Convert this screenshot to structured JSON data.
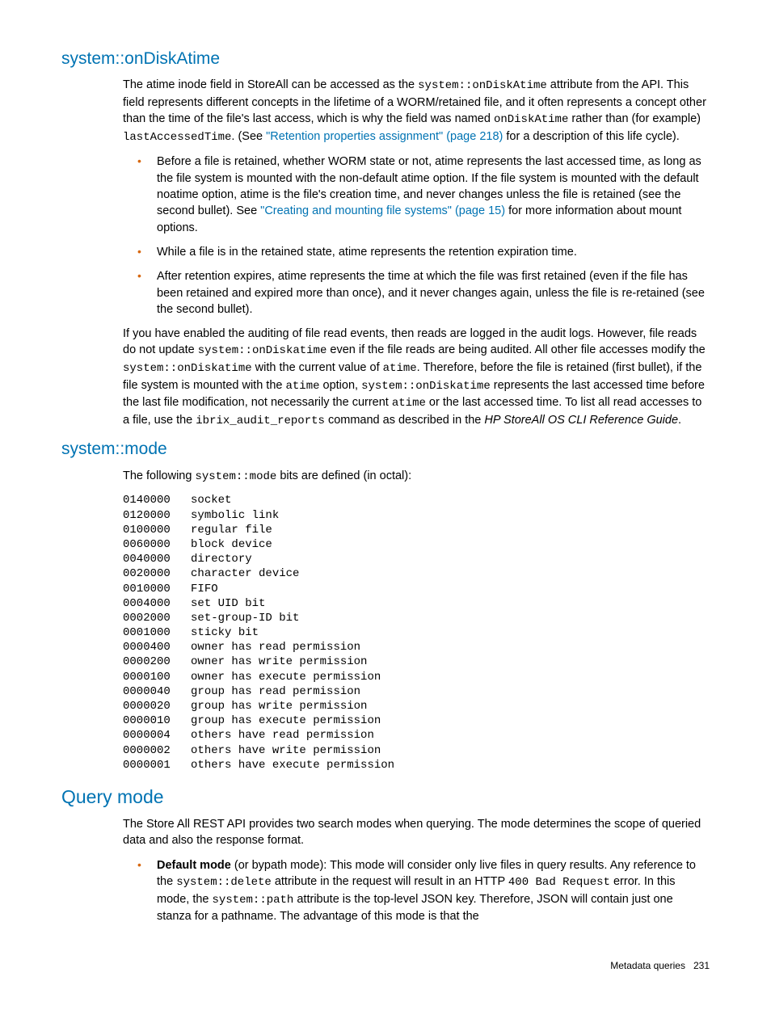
{
  "s1": {
    "h": "system::onDiskAtime",
    "p1a": "The atime inode field in StoreAll can be accessed as the ",
    "p1b": "system::onDiskAtime",
    "p1c": " attribute from the API. This field represents different concepts in the lifetime of a WORM/retained file, and it often represents a concept other than the time of the file's last access, which is why the field was named ",
    "p1d": "onDiskAtime",
    "p1e": " rather than (for example) ",
    "p1f": "lastAccessedTime",
    "p1g": ". (See ",
    "p1h": "\"Retention properties assignment\" (page 218)",
    "p1i": " for a description of this life cycle).",
    "b1a": "Before a file is retained, whether WORM state or not, atime represents the last accessed time, as long as the file system is mounted with the non-default atime option. If the file system is mounted with the default noatime option, atime is the file's creation time, and never changes unless the file is retained (see the second bullet). See ",
    "b1b": "\"Creating and mounting file systems\" (page 15)",
    "b1c": " for more information about mount options.",
    "b2": "While a file is in the retained state, atime represents the retention expiration time.",
    "b3": "After retention expires, atime represents the time at which the file was first retained (even if the file has been retained and expired more than once), and it never changes again, unless the file is re-retained (see the second bullet).",
    "p2a": "If you have enabled the auditing of file read events, then reads are logged in the audit logs. However, file reads do not update ",
    "p2b": "system::onDiskatime",
    "p2c": " even if the file reads are being audited. All other file accesses modify the ",
    "p2d": "system::onDiskatime",
    "p2e": " with the current value of ",
    "p2f": "atime",
    "p2g": ". Therefore, before the file is retained (first bullet), if the file system is mounted with the ",
    "p2h": "atime",
    "p2i": " option, ",
    "p2j": "system::onDiskatime",
    "p2k": " represents the last accessed time before the last file modification, not necessarily the current ",
    "p2l": "atime",
    "p2m": " or the last accessed time. To list all read accesses to a file, use the ",
    "p2n": "ibrix_audit_reports",
    "p2o": " command as described in the ",
    "p2p": "HP StoreAll OS CLI Reference Guide",
    "p2q": "."
  },
  "s2": {
    "h": "system::mode",
    "p1a": "The following ",
    "p1b": " system::mode",
    "p1c": " bits are defined (in octal):",
    "pre": "0140000   socket\n0120000   symbolic link\n0100000   regular file\n0060000   block device\n0040000   directory\n0020000   character device\n0010000   FIFO\n0004000   set UID bit\n0002000   set-group-ID bit\n0001000   sticky bit\n0000400   owner has read permission\n0000200   owner has write permission\n0000100   owner has execute permission\n0000040   group has read permission\n0000020   group has write permission\n0000010   group has execute permission\n0000004   others have read permission\n0000002   others have write permission\n0000001   others have execute permission"
  },
  "s3": {
    "h": "Query mode",
    "p1": "The Store All REST API provides two search modes when querying. The mode determines the scope of queried data and also the response format.",
    "b1a": "Default mode",
    "b1b": " (or bypath mode): This mode will consider only live files in query results. Any reference to the ",
    "b1c": "system::delete",
    "b1d": " attribute in the request will result in an HTTP ",
    "b1e": "400 Bad Request",
    "b1f": " error. In this mode, the ",
    "b1g": "system::path",
    "b1h": " attribute is the top-level JSON key. Therefore, JSON will contain just one stanza for a pathname. The advantage of this mode is that the"
  },
  "footer": {
    "label": "Metadata queries",
    "page": "231"
  }
}
